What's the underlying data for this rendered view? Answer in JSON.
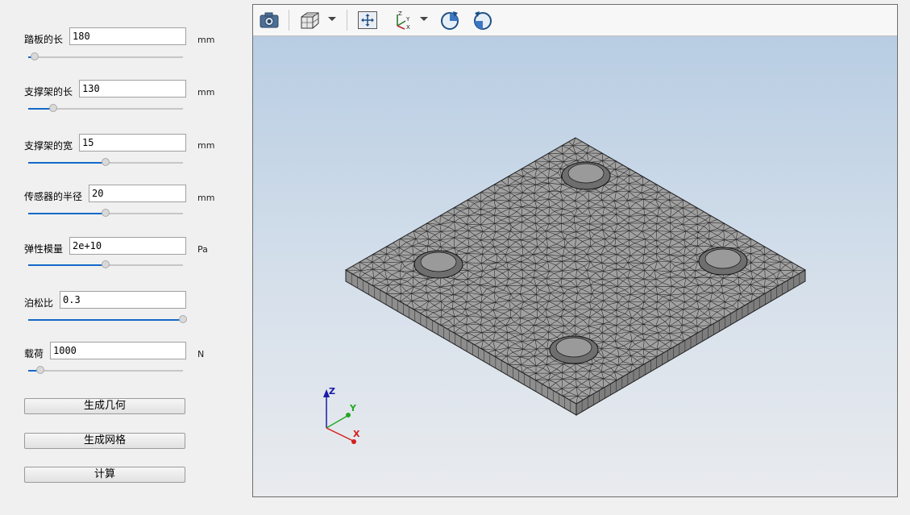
{
  "params": [
    {
      "label": "踏板的长",
      "value": "180",
      "unit": "mm",
      "slider": 0.04
    },
    {
      "label": "支撑架的长",
      "value": "130",
      "unit": "mm",
      "slider": 0.16
    },
    {
      "label": "支撑架的宽",
      "value": "15",
      "unit": "mm",
      "slider": 0.5
    },
    {
      "label": "传感器的半径",
      "value": "20",
      "unit": "mm",
      "slider": 0.5
    },
    {
      "label": "弹性模量",
      "value": "2e+10",
      "unit": "Pa",
      "slider": 0.5
    },
    {
      "label": "泊松比",
      "value": "0.3",
      "unit": "",
      "slider": 1.0
    },
    {
      "label": "载荷",
      "value": "1000",
      "unit": "N",
      "slider": 0.08
    }
  ],
  "buttons": {
    "geometry": "生成几何",
    "mesh": "生成网格",
    "compute": "计算"
  },
  "toolbar": {
    "icons": [
      "camera-icon",
      "view-cube-icon",
      "fit-view-icon",
      "axes-orient-icon",
      "rotate-cw-icon",
      "rotate-ccw-icon"
    ]
  },
  "axes": {
    "x": "X",
    "y": "Y",
    "z": "Z"
  },
  "colors": {
    "accent": "#1469c7",
    "mesh_face": "#9b9b9b",
    "mesh_edge": "#1e1e1e"
  }
}
